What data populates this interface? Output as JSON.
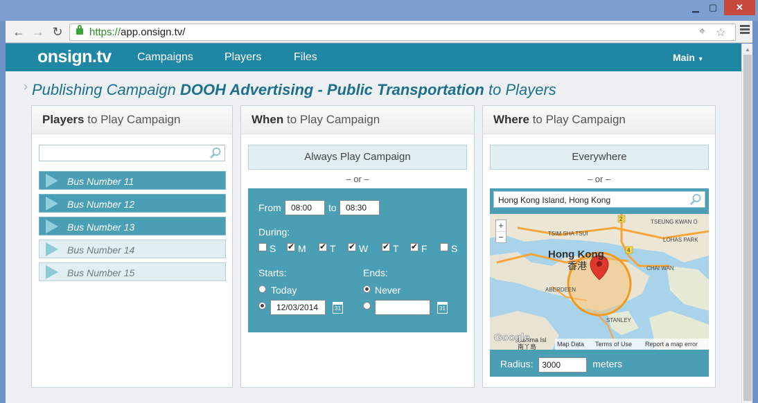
{
  "browser": {
    "url_scheme": "https://",
    "url_rest": "app.onsign.tv/"
  },
  "nav": {
    "logo": "onsign.tv",
    "links": [
      "Campaigns",
      "Players",
      "Files"
    ],
    "account_menu": "Main"
  },
  "heading": {
    "prefix": "Publishing Campaign",
    "campaign_name": "DOOH Advertising - Public Transportation",
    "suffix": "to Players"
  },
  "players_panel": {
    "title_bold": "Players",
    "title_rest": " to Play Campaign",
    "search_value": "",
    "players": [
      {
        "name": "Bus Number 11",
        "selected": true
      },
      {
        "name": "Bus Number 12",
        "selected": true
      },
      {
        "name": "Bus Number 13",
        "selected": true
      },
      {
        "name": "Bus Number 14",
        "selected": false
      },
      {
        "name": "Bus Number 15",
        "selected": false
      }
    ]
  },
  "when_panel": {
    "title_bold": "When",
    "title_rest": " to Play Campaign",
    "always_button": "Always Play Campaign",
    "or": "– or –",
    "from_label": "From",
    "from_value": "08:00",
    "to_label": "to",
    "to_value": "08:30",
    "during_label": "During:",
    "days": [
      {
        "label": "S",
        "checked": false
      },
      {
        "label": "M",
        "checked": true
      },
      {
        "label": "T",
        "checked": true
      },
      {
        "label": "W",
        "checked": true
      },
      {
        "label": "T",
        "checked": true
      },
      {
        "label": "F",
        "checked": true
      },
      {
        "label": "S",
        "checked": false
      }
    ],
    "starts_label": "Starts:",
    "starts_today": "Today",
    "starts_date": "12/03/2014",
    "ends_label": "Ends:",
    "ends_never": "Never",
    "ends_date": "",
    "calendar_day": "31"
  },
  "where_panel": {
    "title_bold": "Where",
    "title_rest": " to Play Campaign",
    "everywhere_button": "Everywhere",
    "or": "– or –",
    "location_value": "Hong Kong Island, Hong Kong",
    "map": {
      "labels": {
        "hong_kong": "Hong Kong",
        "hong_kong_zh": "香港",
        "tsim_sha_tsui": "TSIM SHA TSUI",
        "tseung_kwan_o": "TSEUNG KWAN O",
        "lohas_park": "LOHAS PARK",
        "chai_wan": "CHAI WAN",
        "aberdeen": "ABERDEEN",
        "stanley": "STANLEY",
        "lamma": "Lamma Isl",
        "lamma_zh": "南丫島",
        "route_2": "2",
        "route_4": "4"
      },
      "zoom_in": "+",
      "zoom_out": "−",
      "google": "Google",
      "map_data": "Map Data",
      "terms": "Terms of Use",
      "report": "Report a map error"
    },
    "radius_label": "Radius:",
    "radius_value": "3000",
    "radius_unit": "meters"
  }
}
